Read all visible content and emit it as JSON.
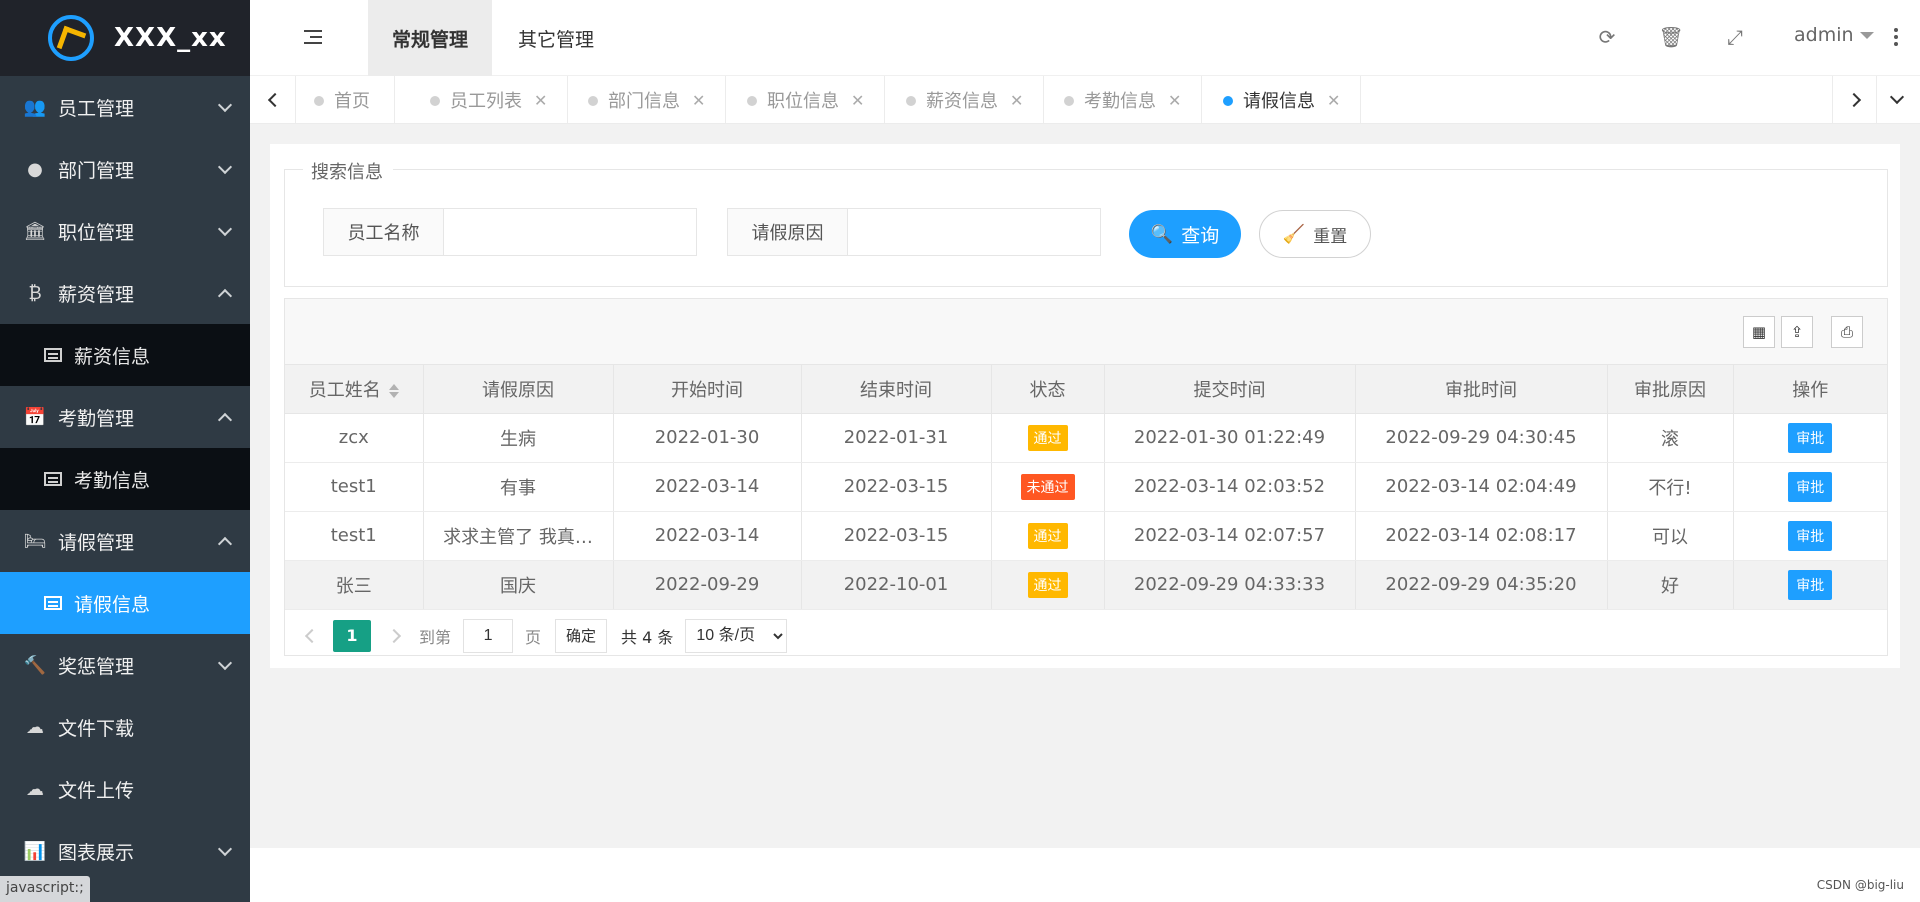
{
  "sidebar": {
    "logo_text": "XXX_xx",
    "menu": [
      {
        "label": "员工管理",
        "icon": "users-icon",
        "state": "collapsed"
      },
      {
        "label": "部门管理",
        "icon": "user-icon",
        "state": "collapsed"
      },
      {
        "label": "职位管理",
        "icon": "bank-icon",
        "state": "collapsed"
      },
      {
        "label": "薪资管理",
        "icon": "bitcoin-icon",
        "state": "expanded",
        "sub": "薪资信息"
      },
      {
        "label": "考勤管理",
        "icon": "calendar-icon",
        "state": "expanded",
        "sub": "考勤信息"
      },
      {
        "label": "请假管理",
        "icon": "bed-icon",
        "state": "expanded",
        "sub": "请假信息"
      },
      {
        "label": "奖惩管理",
        "icon": "gavel-icon",
        "state": "collapsed"
      },
      {
        "label": "文件下载",
        "icon": "cloud-download-icon",
        "state": "none"
      },
      {
        "label": "文件上传",
        "icon": "cloud-upload-icon",
        "state": "none"
      },
      {
        "label": "图表展示",
        "icon": "bar-chart-icon",
        "state": "collapsed"
      }
    ],
    "status_text": "javascript:;"
  },
  "header": {
    "tabs": [
      "常规管理",
      "其它管理"
    ],
    "user": "admin"
  },
  "page_tabs": [
    {
      "label": "首页",
      "closable": false
    },
    {
      "label": "员工列表",
      "closable": true
    },
    {
      "label": "部门信息",
      "closable": true
    },
    {
      "label": "职位信息",
      "closable": true
    },
    {
      "label": "薪资信息",
      "closable": true
    },
    {
      "label": "考勤信息",
      "closable": true
    },
    {
      "label": "请假信息",
      "closable": true,
      "active": true
    }
  ],
  "search": {
    "legend": "搜索信息",
    "name_label": "员工名称",
    "name_value": "",
    "reason_label": "请假原因",
    "reason_value": "",
    "search_button": "查询",
    "reset_button": "重置"
  },
  "table": {
    "columns": [
      "员工姓名",
      "请假原因",
      "开始时间",
      "结束时间",
      "状态",
      "提交时间",
      "审批时间",
      "审批原因",
      "操作"
    ],
    "rows": [
      [
        "zcx",
        "生病",
        "2022-01-30",
        "2022-01-31",
        "通过",
        "2022-01-30 01:22:49",
        "2022-09-29 04:30:45",
        "滚",
        "审批"
      ],
      [
        "test1",
        "有事",
        "2022-03-14",
        "2022-03-15",
        "未通过",
        "2022-03-14 02:03:52",
        "2022-03-14 02:04:49",
        "不行!",
        "审批"
      ],
      [
        "test1",
        "求求主管了 我真…",
        "2022-03-14",
        "2022-03-15",
        "通过",
        "2022-03-14 02:07:57",
        "2022-03-14 02:08:17",
        "可以",
        "审批"
      ],
      [
        "张三",
        "国庆",
        "2022-09-29",
        "2022-10-01",
        "通过",
        "2022-09-29 04:33:33",
        "2022-09-29 04:35:20",
        "好",
        "审批"
      ]
    ],
    "status_colors": {
      "通过": "#ffb800",
      "未通过": "#ff5722"
    }
  },
  "pagination": {
    "current_page": "1",
    "goto_label": "到第",
    "goto_value": "1",
    "page_unit": "页",
    "confirm": "确定",
    "total": "共 4 条",
    "page_size": "10 条/页"
  },
  "watermark": "CSDN @big-liu",
  "colors": {
    "accent": "#1e9fff",
    "sidebar": "#2f3a44",
    "page_active": "#16a085"
  }
}
